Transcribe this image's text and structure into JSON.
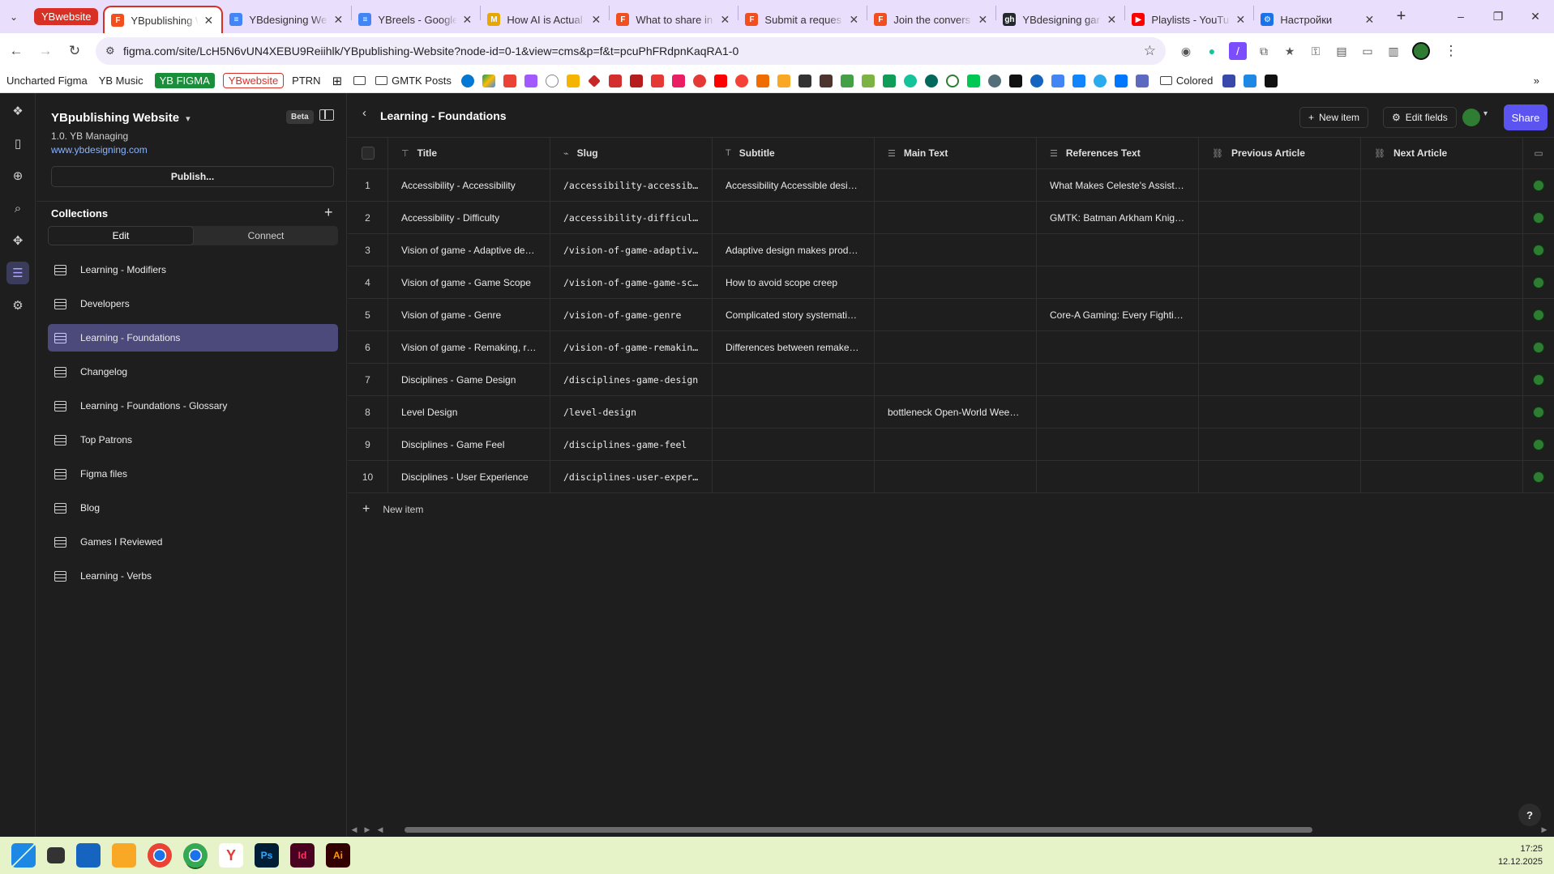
{
  "browser": {
    "tab_group": "YBwebsite",
    "tabs": [
      {
        "title": "YBpublishing We",
        "icon": "figma-icon",
        "color": "#f24e1e",
        "active": true
      },
      {
        "title": "YBdesigning We",
        "icon": "docs-icon",
        "color": "#4285f4"
      },
      {
        "title": "YBreels - Google",
        "icon": "docs-icon",
        "color": "#4285f4"
      },
      {
        "title": "How AI is Actual",
        "icon": "medium-icon",
        "color": "#e6a700"
      },
      {
        "title": "What to share in",
        "icon": "figma-icon",
        "color": "#f24e1e"
      },
      {
        "title": "Submit a reques",
        "icon": "figma-icon",
        "color": "#f24e1e"
      },
      {
        "title": "Join the convers",
        "icon": "figma-icon",
        "color": "#f24e1e"
      },
      {
        "title": "YBdesigning gar",
        "icon": "github-icon",
        "color": "#24292e"
      },
      {
        "title": "Playlists - YouTu",
        "icon": "youtube-icon",
        "color": "#ff0000"
      },
      {
        "title": "Настройки",
        "icon": "gear-icon",
        "color": "#1a73e8"
      }
    ],
    "url": "figma.com/site/LcH5N6vUN4XEBU9Reiihlk/YBpublishing-Website?node-id=0-1&view=cms&p=f&t=pcuPhFRdpnKaqRA1-0"
  },
  "bookmarks": {
    "items": [
      "Uncharted Figma",
      "YB Music"
    ],
    "green_item": "YB FIGMA",
    "red_item": "YBwebsite",
    "plain_item": "PTRN",
    "folder_1": "GMTK Posts",
    "folder_2": "Colored"
  },
  "site": {
    "name": "YBpublishing Website",
    "badge": "Beta",
    "workspace": "1.0. YB Managing",
    "domain": "www.ybdesigning.com",
    "publish_label": "Publish..."
  },
  "collections": {
    "heading": "Collections",
    "seg_edit": "Edit",
    "seg_connect": "Connect",
    "items": [
      "Learning - Modifiers",
      "Developers",
      "Learning - Foundations",
      "Changelog",
      "Learning - Foundations - Glossary",
      "Top Patrons",
      "Figma files",
      "Blog",
      "Games I Reviewed",
      "Learning - Verbs"
    ],
    "selected_index": 2
  },
  "main": {
    "title": "Learning - Foundations",
    "new_item_label": "New item",
    "edit_fields_label": "Edit fields",
    "share_label": "Share",
    "columns": {
      "title": "Title",
      "slug": "Slug",
      "subtitle": "Subtitle",
      "main_text": "Main Text",
      "references": "References Text",
      "previous": "Previous Article",
      "next": "Next Article"
    },
    "rows": [
      {
        "n": "1",
        "title": "Accessibility - Accessibility",
        "slug": "/accessibility-accessibi…",
        "subtitle": "Accessibility Accessible desig…",
        "main": "",
        "ref": "What Makes Celeste's Assist …",
        "prev": "",
        "next": ""
      },
      {
        "n": "2",
        "title": "Accessibility - Difficulty",
        "slug": "/accessibility-difficulty",
        "subtitle": "",
        "main": "",
        "ref": "GMTK: Batman Arkham Knight…",
        "prev": "",
        "next": ""
      },
      {
        "n": "3",
        "title": "Vision of game - Adaptive des…",
        "slug": "/vision-of-game-adaptive…",
        "subtitle": "Adaptive design makes produ…",
        "main": "",
        "ref": "",
        "prev": "",
        "next": ""
      },
      {
        "n": "4",
        "title": "Vision of game - Game Scope",
        "slug": "/vision-of-game-game-sco…",
        "subtitle": "How to avoid scope creep",
        "main": "",
        "ref": "",
        "prev": "",
        "next": ""
      },
      {
        "n": "5",
        "title": "Vision of game - Genre",
        "slug": "/vision-of-game-genre",
        "subtitle": "Complicated story systematiz…",
        "main": "",
        "ref": "Core-A Gaming: Every Fightin…",
        "prev": "",
        "next": ""
      },
      {
        "n": "6",
        "title": "Vision of game - Remaking, re…",
        "slug": "/vision-of-game-remaking…",
        "subtitle": "Differences between remakes,…",
        "main": "",
        "ref": "",
        "prev": "",
        "next": ""
      },
      {
        "n": "7",
        "title": "Disciplines - Game Design",
        "slug": "/disciplines-game-design",
        "subtitle": "",
        "main": "",
        "ref": "",
        "prev": "",
        "next": ""
      },
      {
        "n": "8",
        "title": "Level Design",
        "slug": "/level-design",
        "subtitle": "",
        "main": "bottleneck Open-World Weeni…",
        "ref": "",
        "prev": "",
        "next": ""
      },
      {
        "n": "9",
        "title": "Disciplines - Game Feel",
        "slug": "/disciplines-game-feel",
        "subtitle": "",
        "main": "",
        "ref": "",
        "prev": "",
        "next": ""
      },
      {
        "n": "10",
        "title": "Disciplines - User Experience",
        "slug": "/disciplines-user-experi…",
        "subtitle": "",
        "main": "",
        "ref": "",
        "prev": "",
        "next": ""
      }
    ],
    "add_row_label": "New item",
    "help_label": "?"
  },
  "taskbar": {
    "time": "17:25",
    "date": "12.12.2025"
  },
  "colors": {
    "accent": "#5b54f0",
    "selected_collection": "#4c4a7a",
    "tab_group": "#d93025"
  }
}
